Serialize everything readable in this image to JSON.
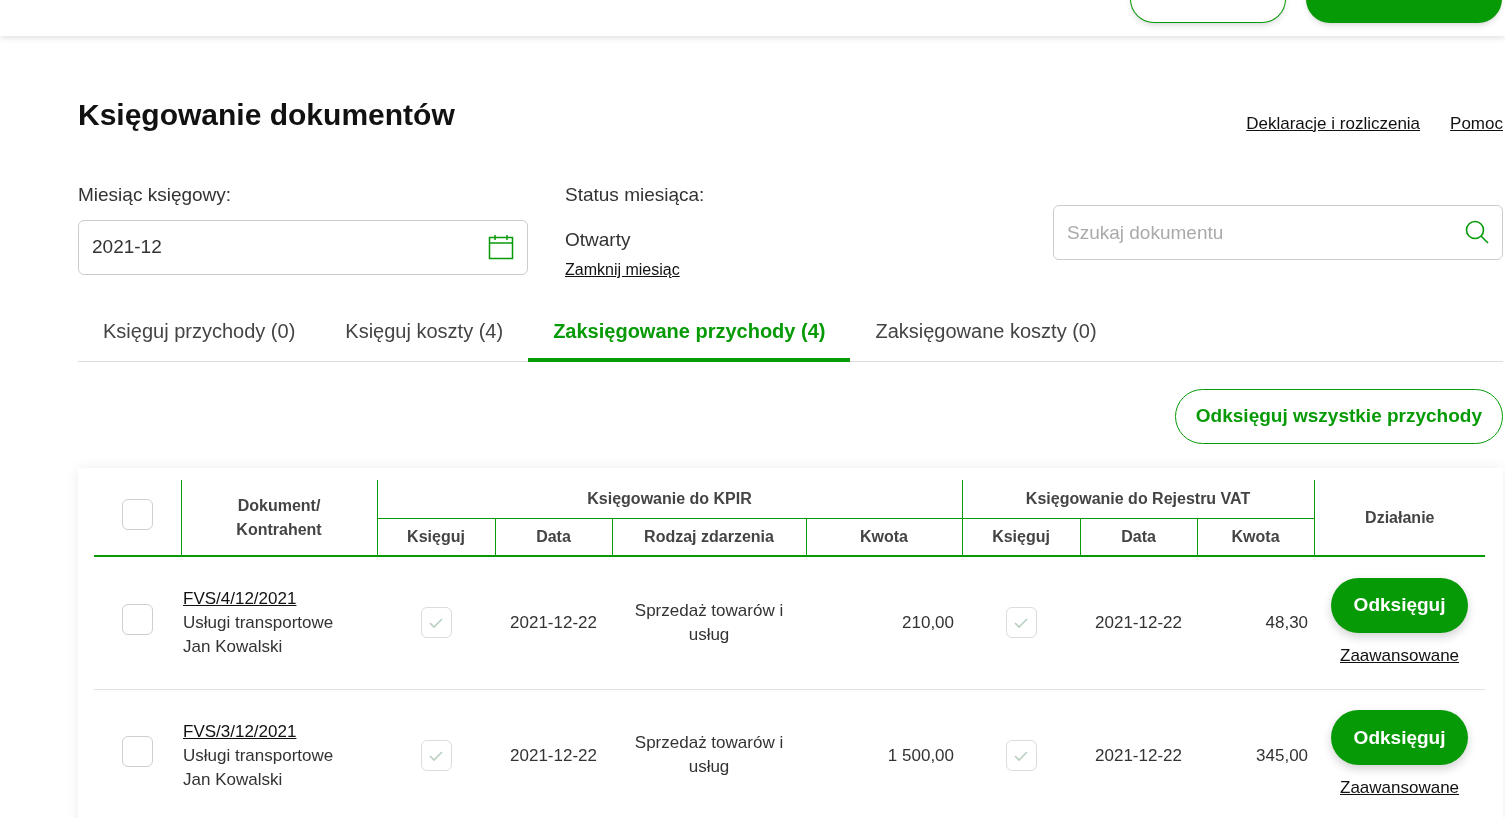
{
  "header": {
    "buttons": [
      {
        "kind": "outline"
      },
      {
        "kind": "filled"
      }
    ]
  },
  "page": {
    "title": "Księgowanie dokumentów",
    "links": [
      "Deklaracje i rozliczenia",
      "Pomoc"
    ]
  },
  "month": {
    "label": "Miesiąc księgowy:",
    "value": "2021-12"
  },
  "status": {
    "label": "Status miesiąca:",
    "value": "Otwarty",
    "action": "Zamknij miesiąc"
  },
  "search": {
    "placeholder": "Szukaj dokumentu"
  },
  "tabs": [
    {
      "label": "Księguj przychody (0)",
      "selected": false
    },
    {
      "label": "Księguj koszty (4)",
      "selected": false
    },
    {
      "label": "Zaksięgowane przychody (4)",
      "selected": true
    },
    {
      "label": "Zaksięgowane koszty (0)",
      "selected": false
    }
  ],
  "bulk_button": "Odksięguj wszystkie przychody",
  "table": {
    "select_all_checked": false,
    "doc_header": "Dokument/ Kontrahent",
    "kpir_header": "Księgowanie do KPIR",
    "vat_header": "Księgowanie do Rejestru VAT",
    "action_header": "Działanie",
    "kpir_columns": [
      "Księguj",
      "Data",
      "Rodzaj zdarzenia",
      "Kwota"
    ],
    "vat_columns": [
      "Księguj",
      "Data",
      "Kwota"
    ],
    "rows": [
      {
        "checked": false,
        "number": "FVS/4/12/2021",
        "description": "Usługi transportowe",
        "contractor": "Jan Kowalski",
        "kpir_checked": true,
        "kpir_date": "2021-12-22",
        "event": "Sprzedaż towarów i usług",
        "kpir_amount": "210,00",
        "vat_checked": true,
        "vat_date": "2021-12-22",
        "vat_amount": "48,30",
        "button": "Odksięguj",
        "link": "Zaawansowane"
      },
      {
        "checked": false,
        "number": "FVS/3/12/2021",
        "description": "Usługi transportowe",
        "contractor": "Jan Kowalski",
        "kpir_checked": true,
        "kpir_date": "2021-12-22",
        "event": "Sprzedaż towarów i usług",
        "kpir_amount": "1 500,00",
        "vat_checked": true,
        "vat_date": "2021-12-22",
        "vat_amount": "345,00",
        "button": "Odksięguj",
        "link": "Zaawansowane"
      }
    ]
  }
}
